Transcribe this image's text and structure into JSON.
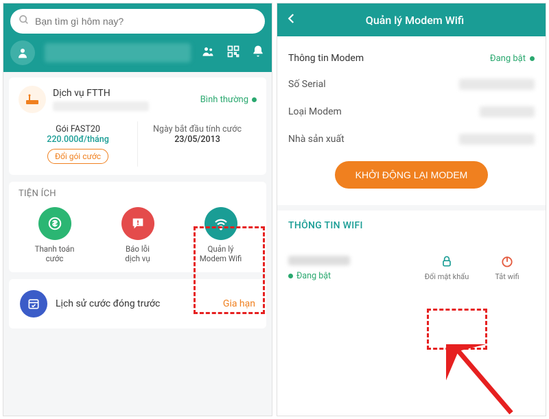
{
  "left": {
    "search_placeholder": "Bạn tìm gì hôm nay?",
    "service": {
      "title": "Dịch vụ FTTH",
      "status": "Bình thường"
    },
    "plan": {
      "name": "Gói FAST20",
      "price": "220.000đ/tháng",
      "change_label": "Đổi gói cước",
      "start_label": "Ngày bắt đầu tính cước",
      "start_date": "23/05/2013"
    },
    "utilities": {
      "header": "TIỆN ÍCH",
      "items": [
        {
          "label": "Thanh toán\ncước"
        },
        {
          "label": "Báo lỗi\ndịch vụ"
        },
        {
          "label": "Quản lý\nModem Wifi"
        }
      ]
    },
    "history": {
      "label": "Lịch sử cước đóng trước",
      "action": "Gia hạn"
    }
  },
  "right": {
    "topbar": "Quản lý Modem Wifi",
    "modem_info_title": "Thông tin Modem",
    "status_on": "Đang bật",
    "rows": {
      "serial": "Số Serial",
      "type": "Loại Modem",
      "vendor": "Nhà sản xuất"
    },
    "restart_btn": "KHỞI ĐỘNG LẠI MODEM",
    "wifi_section": "THÔNG TIN WIFI",
    "wifi_status": "Đang bật",
    "actions": {
      "change_pw": "Đổi mật khẩu",
      "turn_off": "Tắt wifi"
    }
  }
}
